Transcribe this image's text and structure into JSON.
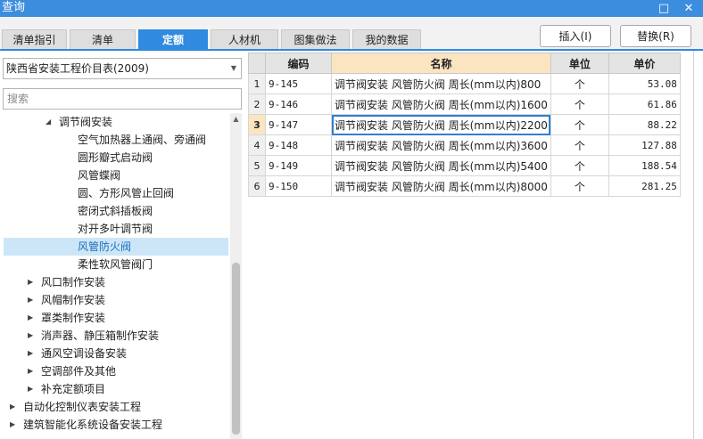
{
  "window": {
    "title": "查询",
    "restore_glyph": "□",
    "close_glyph": "✕"
  },
  "tabs": [
    {
      "label": "清单指引"
    },
    {
      "label": "清单"
    },
    {
      "label": "定额"
    },
    {
      "label": "人材机"
    },
    {
      "label": "图集做法"
    },
    {
      "label": "我的数据"
    }
  ],
  "actions": {
    "insert_label": "插入(I)",
    "replace_label": "替换(R)"
  },
  "left": {
    "library_selected": "陕西省安装工程价目表(2009)",
    "search_placeholder": "搜索"
  },
  "tree": [
    {
      "label": "调节阀安装",
      "caret": "◢"
    },
    {
      "label": "空气加热器上通阀、旁通阀"
    },
    {
      "label": "圆形瓣式启动阀"
    },
    {
      "label": "风管蝶阀"
    },
    {
      "label": "圆、方形风管止回阀"
    },
    {
      "label": "密闭式斜插板阀"
    },
    {
      "label": "对开多叶调节阀"
    },
    {
      "label": "风管防火阀"
    },
    {
      "label": "柔性软风管阀门"
    },
    {
      "label": "风口制作安装",
      "caret": "▶"
    },
    {
      "label": "风帽制作安装",
      "caret": "▶"
    },
    {
      "label": "罩类制作安装",
      "caret": "▶"
    },
    {
      "label": "消声器、静压箱制作安装",
      "caret": "▶"
    },
    {
      "label": "通风空调设备安装",
      "caret": "▶"
    },
    {
      "label": "空调部件及其他",
      "caret": "▶"
    },
    {
      "label": "补充定额项目",
      "caret": "▶"
    },
    {
      "label": "自动化控制仪表安装工程",
      "caret": "▶"
    },
    {
      "label": "建筑智能化系统设备安装工程",
      "caret": "▶"
    }
  ],
  "scroll_up_glyph": "▲",
  "table": {
    "headers": {
      "code": "编码",
      "name": "名称",
      "unit": "单位",
      "price": "单价"
    },
    "rows": [
      {
        "num": "1",
        "code": "9-145",
        "name": "调节阀安装 风管防火阀 周长(mm以内)800",
        "unit": "个",
        "price": "53.08"
      },
      {
        "num": "2",
        "code": "9-146",
        "name": "调节阀安装 风管防火阀 周长(mm以内)1600",
        "unit": "个",
        "price": "61.86"
      },
      {
        "num": "3",
        "code": "9-147",
        "name": "调节阀安装 风管防火阀 周长(mm以内)2200",
        "unit": "个",
        "price": "88.22"
      },
      {
        "num": "4",
        "code": "9-148",
        "name": "调节阀安装 风管防火阀 周长(mm以内)3600",
        "unit": "个",
        "price": "127.88"
      },
      {
        "num": "5",
        "code": "9-149",
        "name": "调节阀安装 风管防火阀 周长(mm以内)5400",
        "unit": "个",
        "price": "188.54"
      },
      {
        "num": "6",
        "code": "9-150",
        "name": "调节阀安装 风管防火阀 周长(mm以内)8000",
        "unit": "个",
        "price": "281.25"
      }
    ]
  }
}
